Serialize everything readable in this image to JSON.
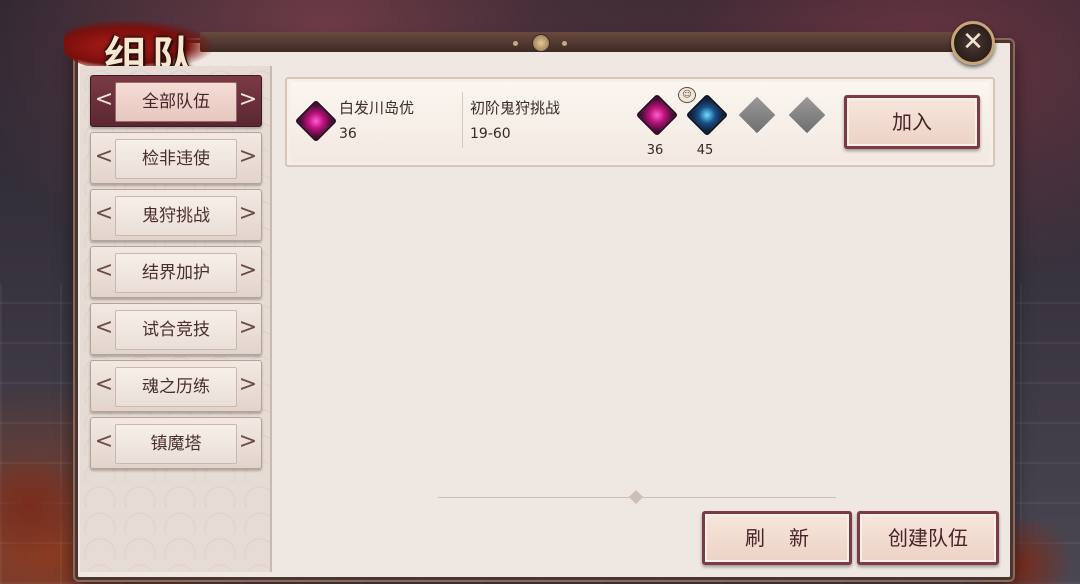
{
  "title": "组队",
  "close_icon": "close-icon",
  "sidebar": {
    "items": [
      {
        "label": "全部队伍",
        "active": true
      },
      {
        "label": "检非违使",
        "active": false
      },
      {
        "label": "鬼狩挑战",
        "active": false
      },
      {
        "label": "结界加护",
        "active": false
      },
      {
        "label": "试合竞技",
        "active": false
      },
      {
        "label": "魂之历练",
        "active": false
      },
      {
        "label": "镇魔塔",
        "active": false
      }
    ]
  },
  "teams": [
    {
      "leader_name": "白发川岛优",
      "leader_level": "36",
      "activity": "初阶鬼狩挑战",
      "level_range": "19-60",
      "members": [
        {
          "level": "36",
          "icon": "pink-shuriken-icon"
        },
        {
          "level": "45",
          "icon": "blue-bow-icon"
        },
        {
          "level": "",
          "icon": "empty-slot-icon"
        },
        {
          "level": "",
          "icon": "empty-slot-icon"
        }
      ],
      "join_label": "加入"
    }
  ],
  "footer": {
    "refresh_label": "刷新",
    "create_label": "创建队伍"
  },
  "colors": {
    "accent": "#7b3a45",
    "panel": "#efe8e2"
  }
}
